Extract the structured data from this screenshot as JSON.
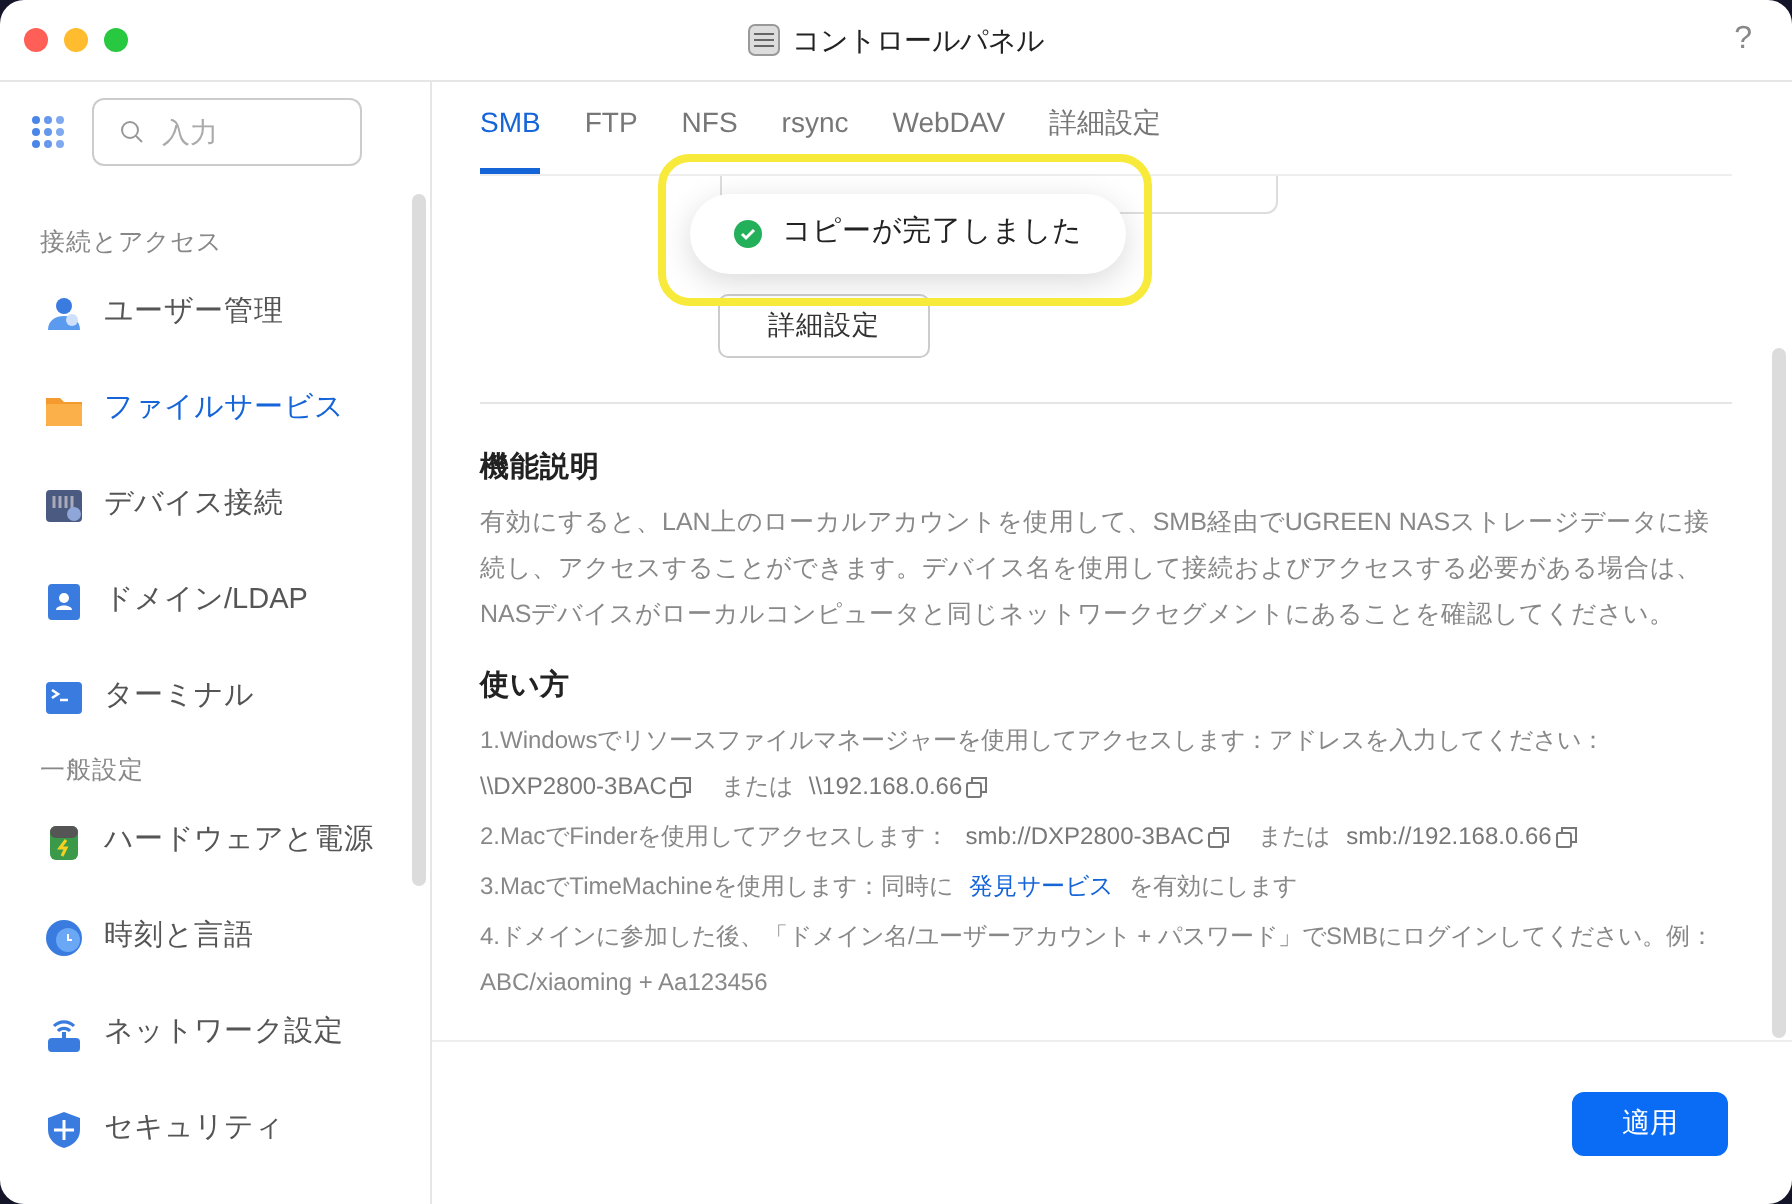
{
  "window": {
    "title": "コントロールパネル",
    "help": "?"
  },
  "sidebar": {
    "search": {
      "placeholder": "入力"
    },
    "sections": [
      {
        "title": "接続とアクセス",
        "items": [
          {
            "label": "ユーザー管理",
            "selected": false
          },
          {
            "label": "ファイルサービス",
            "selected": true
          },
          {
            "label": "デバイス接続",
            "selected": false
          },
          {
            "label": "ドメイン/LDAP",
            "selected": false
          },
          {
            "label": "ターミナル",
            "selected": false
          }
        ]
      },
      {
        "title": "一般設定",
        "items": [
          {
            "label": "ハードウェアと電源",
            "selected": false
          },
          {
            "label": "時刻と言語",
            "selected": false
          },
          {
            "label": "ネットワーク設定",
            "selected": false
          },
          {
            "label": "セキュリティ",
            "selected": false
          }
        ]
      }
    ]
  },
  "tabs": [
    {
      "label": "SMB",
      "selected": true
    },
    {
      "label": "FTP",
      "selected": false
    },
    {
      "label": "NFS",
      "selected": false
    },
    {
      "label": "rsync",
      "selected": false
    },
    {
      "label": "WebDAV",
      "selected": false
    },
    {
      "label": "詳細設定",
      "selected": false
    }
  ],
  "advanced_button": "詳細設定",
  "description": {
    "title": "機能説明",
    "text": "有効にすると、LAN上のローカルアカウントを使用して、SMB経由でUGREEN NASストレージデータに接続し、アクセスすることができます。デバイス名を使用して接続およびアクセスする必要がある場合は、NASデバイスがローカルコンピュータと同じネットワークセグメントにあることを確認してください。"
  },
  "usage": {
    "title": "使い方",
    "steps": [
      {
        "lines": [
          [
            {
              "kind": "text",
              "text": "1.Windowsでリソースファイルマネージャーを使用してアクセスします：アドレスを入力してください："
            }
          ],
          [
            {
              "kind": "copy",
              "text": "\\\\DXP2800-3BAC"
            },
            {
              "kind": "text",
              "text": "または"
            },
            {
              "kind": "copy",
              "text": "\\\\192.168.0.66"
            }
          ]
        ]
      },
      {
        "lines": [
          [
            {
              "kind": "text",
              "text": "2.MacでFinderを使用してアクセスします："
            },
            {
              "kind": "copy",
              "text": "smb://DXP2800-3BAC"
            },
            {
              "kind": "text",
              "text": "または"
            },
            {
              "kind": "copy",
              "text": "smb://192.168.0.66"
            }
          ]
        ]
      },
      {
        "lines": [
          [
            {
              "kind": "text",
              "text": "3.MacでTimeMachineを使用します：同時に"
            },
            {
              "kind": "link",
              "text": "発見サービス"
            },
            {
              "kind": "text",
              "text": "を有効にします"
            }
          ]
        ]
      },
      {
        "lines": [
          [
            {
              "kind": "text",
              "text": "4.ドメインに参加した後、「ドメイン名/ユーザーアカウント + パスワード」でSMBにログインしてください。例：ABC/xiaoming + Aa123456"
            }
          ]
        ]
      }
    ]
  },
  "apply_button": "適用",
  "toast": {
    "text": "コピーが完了しました",
    "highlighted": true
  }
}
